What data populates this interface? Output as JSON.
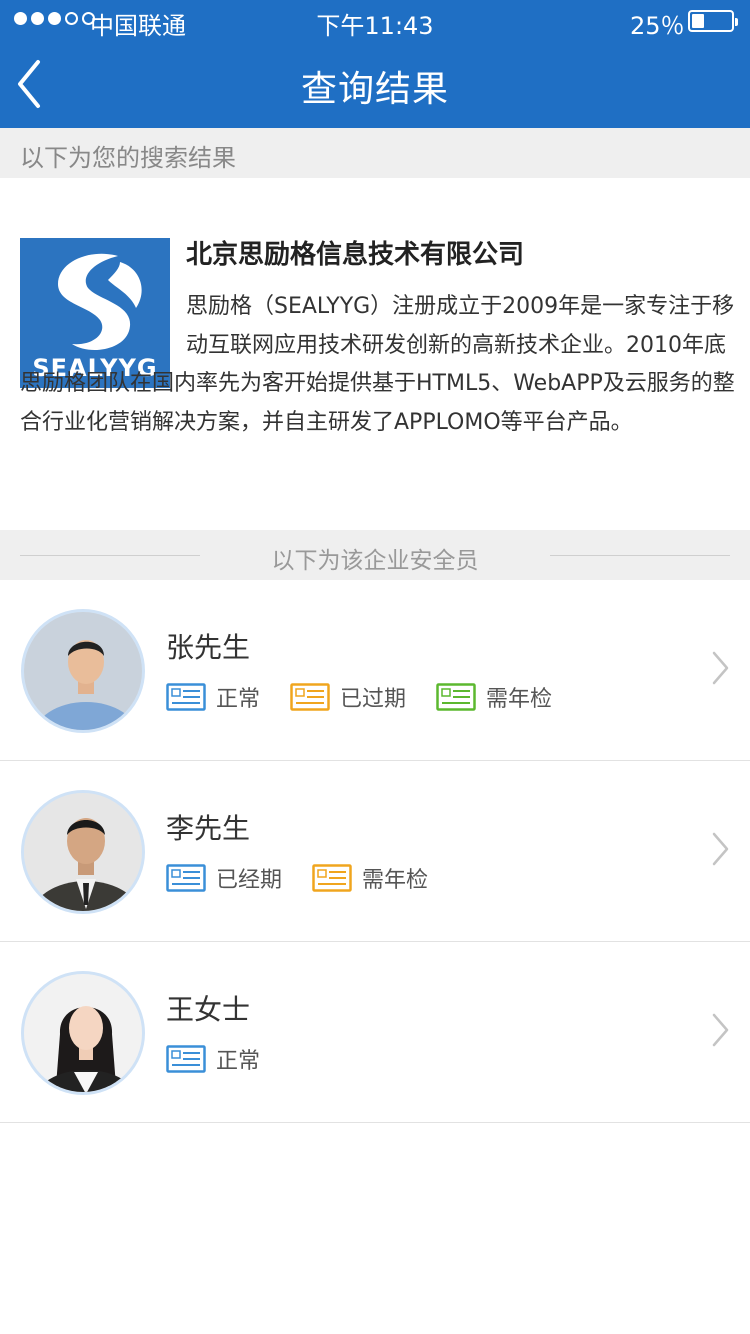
{
  "status_bar": {
    "carrier": "中国联通",
    "time": "下午11:43",
    "battery": "25％",
    "battery_level": 0.25
  },
  "nav": {
    "title": "查询结果",
    "back_icon": "chevron-left-icon"
  },
  "results_header": "以下为您的搜索结果",
  "company": {
    "name": "北京思励格信息技术有限公司",
    "logo_text": "SEALYYG",
    "description": "思励格（SEALYYG）注册成立于2009年是一家专注于移动互联网应用技术研发创新的高新技术企业。2010年底思励格团队在国内率先为客开始提供基于HTML5、WebAPP及云服务的整合行业化营销解决方案，并自主研发了APPLOMO等平台产品。"
  },
  "staff_header": "以下为该企业安全员",
  "staff": [
    {
      "name": "张先生",
      "tags": [
        {
          "label": "正常",
          "color": "#3a8fd8",
          "icon": "id-card-icon"
        },
        {
          "label": "已过期",
          "color": "#f0a51e",
          "icon": "id-card-icon"
        },
        {
          "label": "需年检",
          "color": "#5cb82f",
          "icon": "id-card-icon"
        }
      ]
    },
    {
      "name": "李先生",
      "tags": [
        {
          "label": "已经期",
          "color": "#3a8fd8",
          "icon": "id-card-icon"
        },
        {
          "label": "需年检",
          "color": "#f0a51e",
          "icon": "id-card-icon"
        }
      ]
    },
    {
      "name": "王女士",
      "tags": [
        {
          "label": "正常",
          "color": "#3a8fd8",
          "icon": "id-card-icon"
        }
      ]
    }
  ],
  "colors": {
    "primary": "#1f6fc4",
    "section_bg": "#efefef"
  }
}
